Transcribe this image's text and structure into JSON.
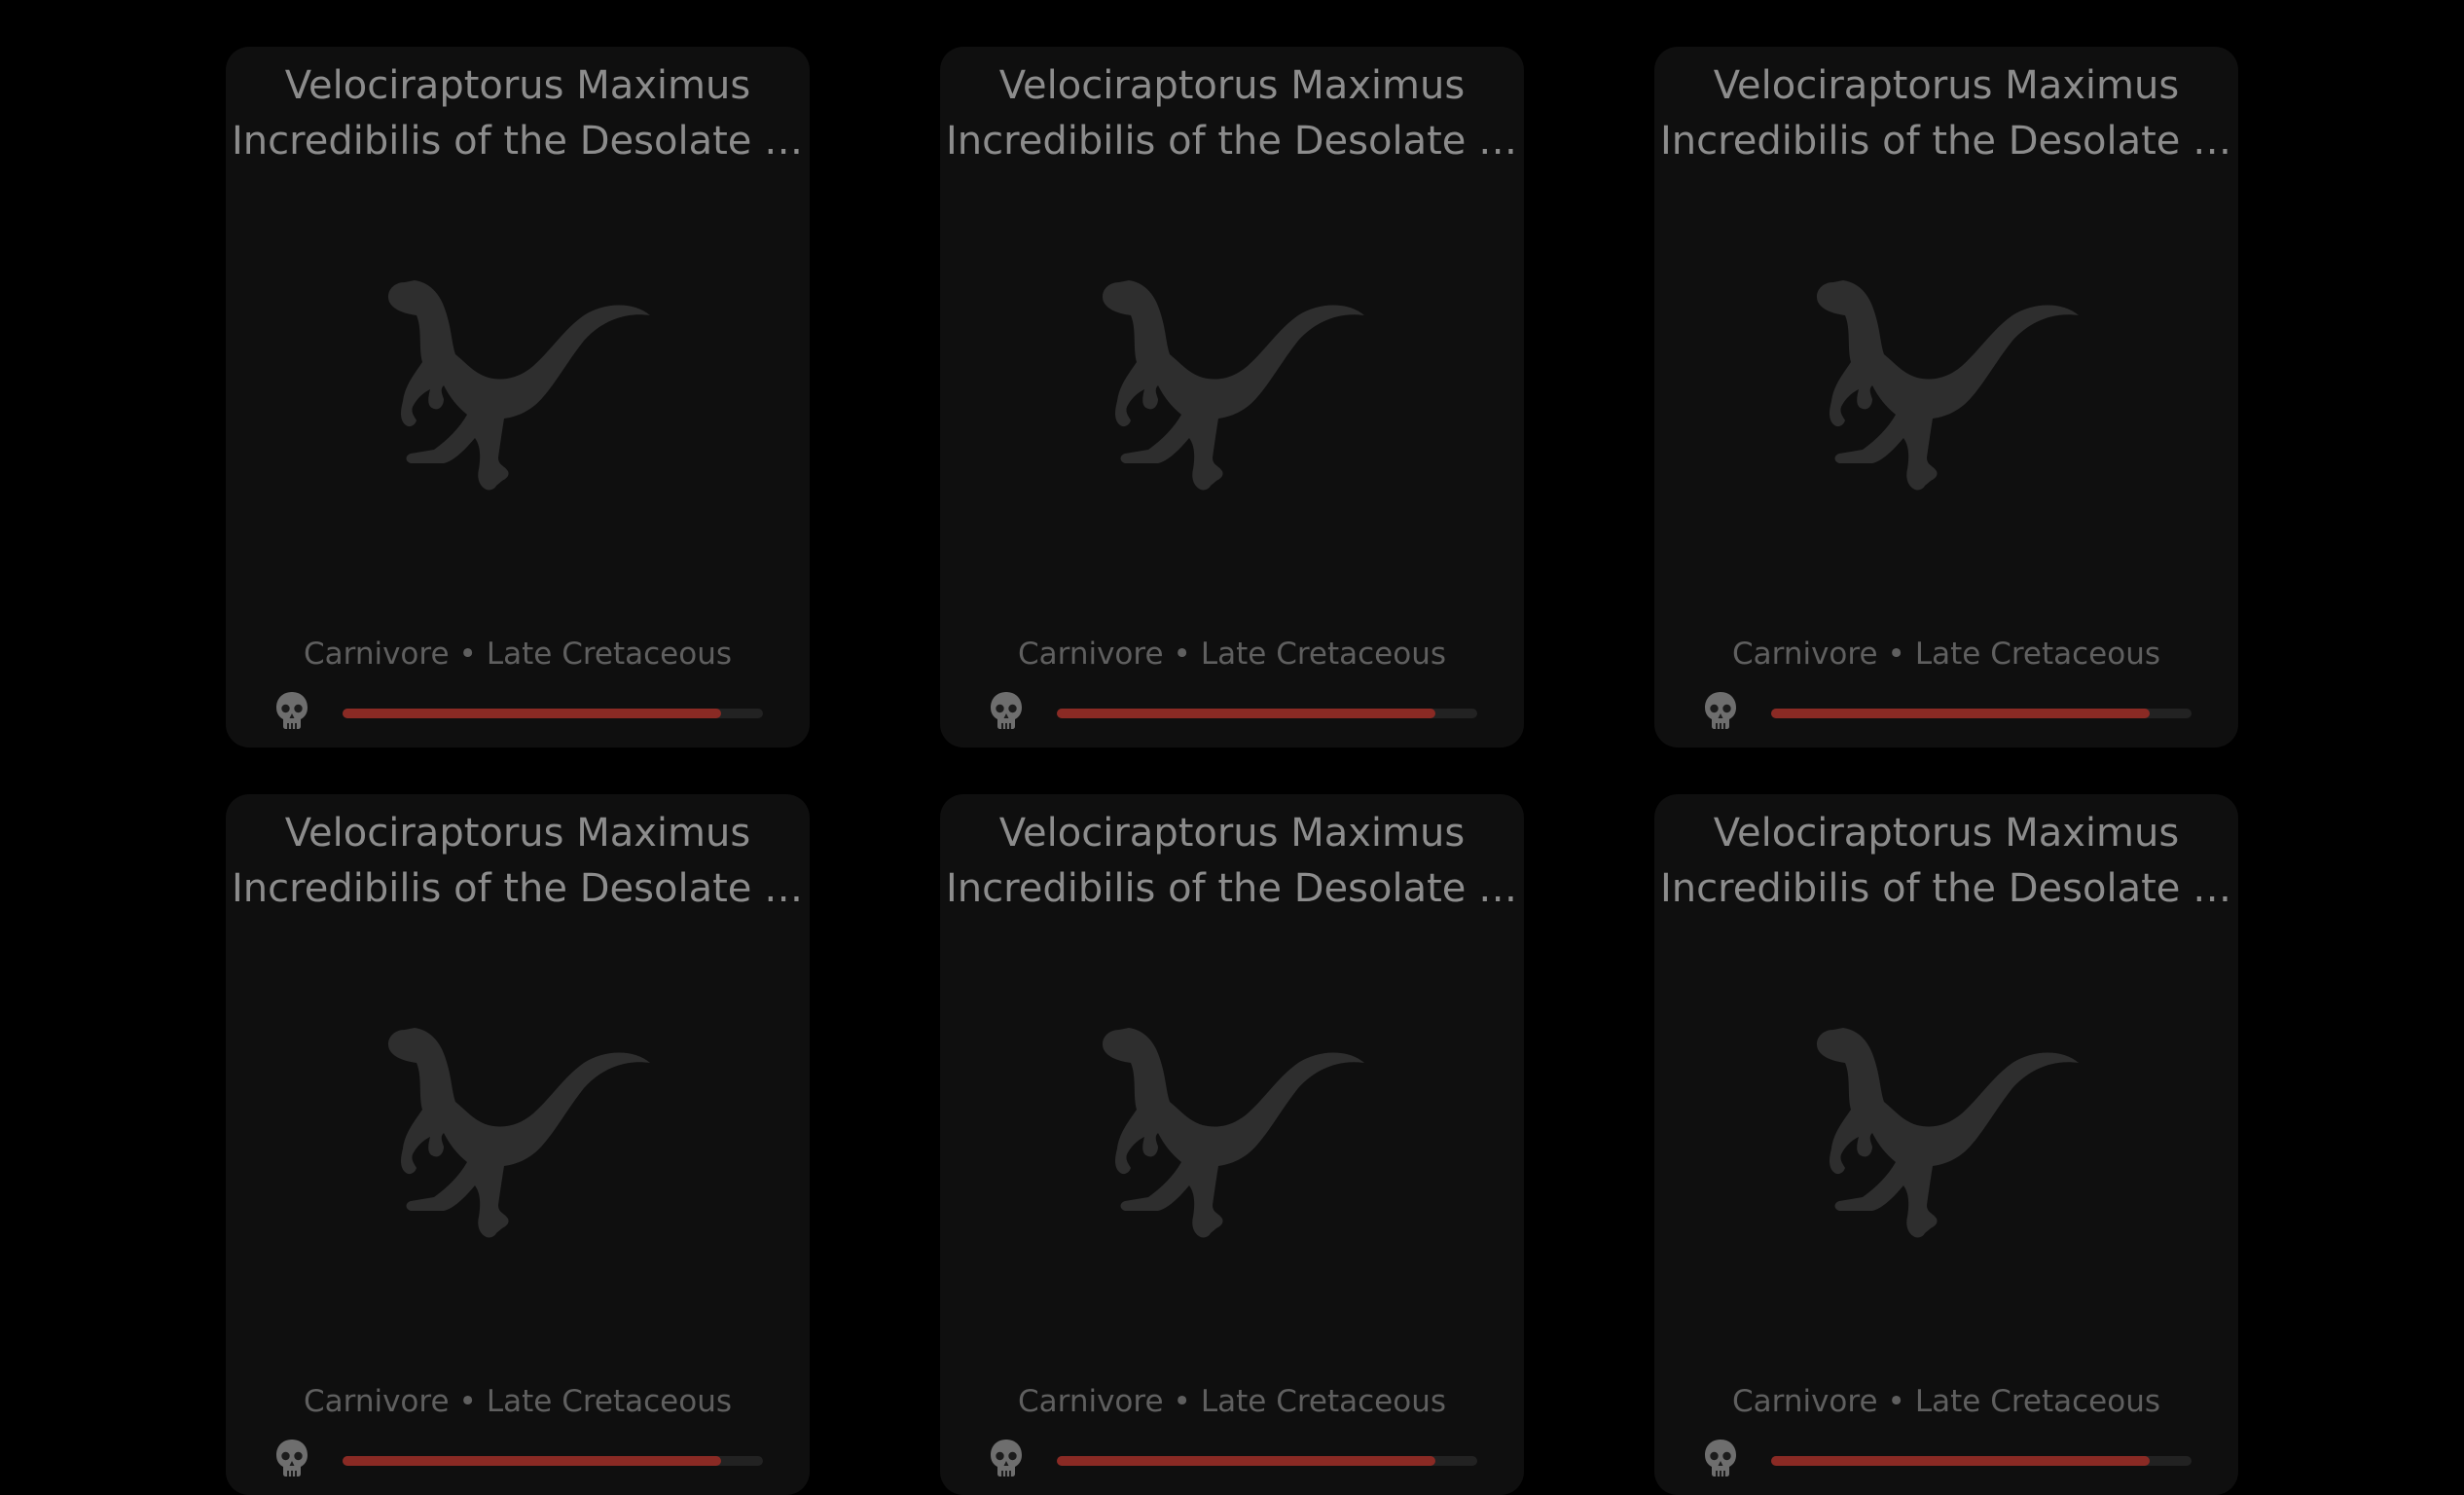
{
  "cards": [
    {
      "title_line1": "Velociraptorus Maximus",
      "title_line2": "Incredibilis of the Desolate E…",
      "diet": "Carnivore",
      "separator": "•",
      "period": "Late Cretaceous",
      "icon": "skull-icon",
      "danger_level": 0.9
    },
    {
      "title_line1": "Velociraptorus Maximus",
      "title_line2": "Incredibilis of the Desolate E…",
      "diet": "Carnivore",
      "separator": "•",
      "period": "Late Cretaceous",
      "icon": "skull-icon",
      "danger_level": 0.9
    },
    {
      "title_line1": "Velociraptorus Maximus",
      "title_line2": "Incredibilis of the Desolate E…",
      "diet": "Carnivore",
      "separator": "•",
      "period": "Late Cretaceous",
      "icon": "skull-icon",
      "danger_level": 0.9
    },
    {
      "title_line1": "Velociraptorus Maximus",
      "title_line2": "Incredibilis of the Desolate E…",
      "diet": "Carnivore",
      "separator": "•",
      "period": "Late Cretaceous",
      "icon": "skull-icon",
      "danger_level": 0.9
    },
    {
      "title_line1": "Velociraptorus Maximus",
      "title_line2": "Incredibilis of the Desolate E…",
      "diet": "Carnivore",
      "separator": "•",
      "period": "Late Cretaceous",
      "icon": "skull-icon",
      "danger_level": 0.9
    },
    {
      "title_line1": "Velociraptorus Maximus",
      "title_line2": "Incredibilis of the Desolate E…",
      "diet": "Carnivore",
      "separator": "•",
      "period": "Late Cretaceous",
      "icon": "skull-icon",
      "danger_level": 0.9
    }
  ],
  "colors": {
    "background": "#000000",
    "card": "#0f0f0f",
    "silhouette": "#2e2e2e",
    "danger_bar": "#8a2a24",
    "bar_track": "#222222"
  }
}
